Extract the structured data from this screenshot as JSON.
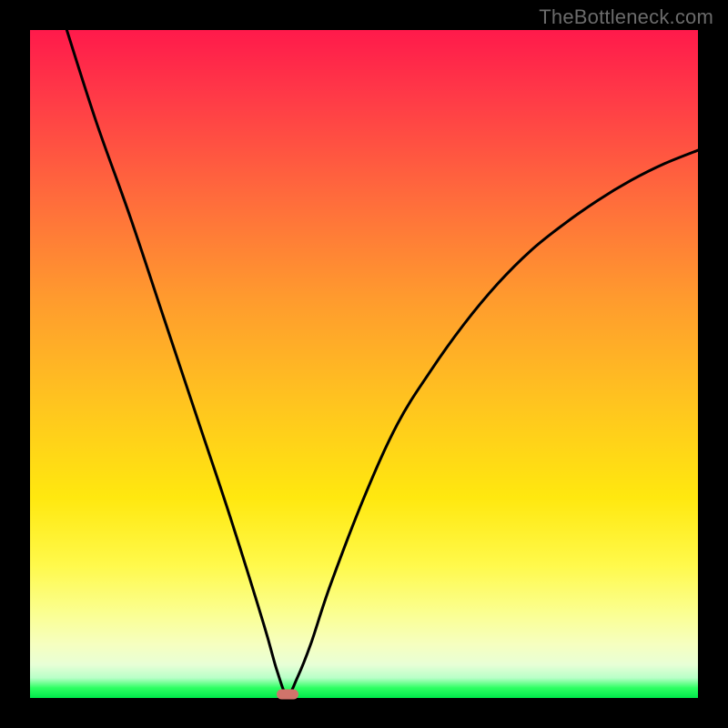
{
  "watermark": "TheBottleneck.com",
  "chart_data": {
    "type": "line",
    "title": "",
    "xlabel": "",
    "ylabel": "",
    "xlim": [
      0,
      100
    ],
    "ylim": [
      0,
      100
    ],
    "grid": false,
    "series": [
      {
        "name": "curve",
        "x": [
          5.5,
          10,
          15,
          20,
          25,
          30,
          35,
          37,
          38.5,
          40,
          42,
          45,
          50,
          55,
          60,
          65,
          70,
          75,
          80,
          85,
          90,
          95,
          100
        ],
        "y": [
          100,
          86,
          72,
          57,
          42,
          27,
          11,
          4,
          0.5,
          3,
          8,
          17,
          30,
          41,
          49,
          56,
          62,
          67,
          71,
          74.5,
          77.5,
          80,
          82
        ]
      }
    ],
    "marker": {
      "x": 38.5,
      "y": 0.5
    },
    "background_gradient": {
      "orientation": "vertical",
      "stops": [
        {
          "pct": 0,
          "color": "#ff1a4b"
        },
        {
          "pct": 25,
          "color": "#ff6b3c"
        },
        {
          "pct": 55,
          "color": "#ffc220"
        },
        {
          "pct": 80,
          "color": "#fff94a"
        },
        {
          "pct": 95,
          "color": "#e8ffd6"
        },
        {
          "pct": 100,
          "color": "#00e84a"
        }
      ]
    }
  },
  "colors": {
    "frame_bg": "#000000",
    "curve_stroke": "#000000",
    "marker_fill": "#d0746b",
    "watermark_text": "#6b6b6b"
  }
}
